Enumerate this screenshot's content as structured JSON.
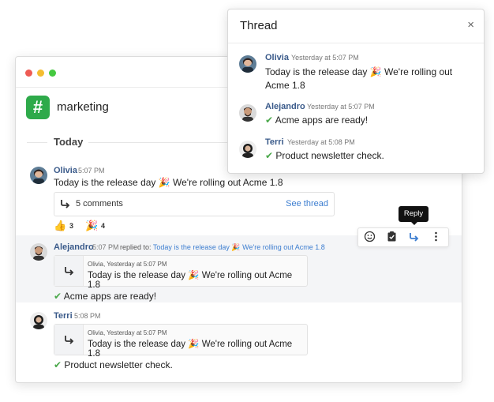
{
  "channel": {
    "name": "marketing",
    "hash_symbol": "#",
    "day_label": "Today"
  },
  "colors": {
    "accent": "#3d7ed0",
    "green": "#2eaa4a",
    "close": "#ee5b54",
    "minimize": "#f4bd30",
    "zoom": "#45c940"
  },
  "messages": [
    {
      "author": "Olivia",
      "time": "5:07 PM",
      "text": "Today is the release day 🎉 We're rolling out Acme 1.8"
    },
    {
      "author": "Alejandro",
      "time": "5:07 PM",
      "text": "Acme apps are ready!",
      "replied_prefix": "replied to:",
      "replied_text": "Today is the release day 🎉 We're rolling out Acme 1.8",
      "quote_meta": "Olivia, Yesterday at 5:07 PM",
      "quote_text": "Today is the release day 🎉 We're rolling out Acme 1.8"
    },
    {
      "author": "Terri",
      "time": "5:08 PM",
      "text": "Product newsletter check.",
      "quote_meta": "Olivia, Yesterday at 5:07 PM",
      "quote_text": "Today is the release day 🎉 We're rolling out Acme 1.8"
    }
  ],
  "comments": {
    "count_label": "5 comments",
    "see_thread": "See thread"
  },
  "reactions": [
    {
      "emoji": "👍",
      "count": "3"
    },
    {
      "emoji": "🎉",
      "count": "4"
    }
  ],
  "toolbar": {
    "tooltip": "Reply",
    "icons": [
      "smile-icon",
      "task-icon",
      "reply-icon",
      "more-icon"
    ]
  },
  "thread": {
    "title": "Thread",
    "close": "×",
    "items": [
      {
        "author": "Olivia",
        "time": "Yesterday at 5:07 PM",
        "text": "Today is the release day 🎉 We're rolling out Acme 1.8"
      },
      {
        "author": "Alejandro",
        "time": "Yesterday at 5:07 PM",
        "text": "Acme apps are ready!"
      },
      {
        "author": "Terri",
        "time": "Yesterday at 5:08 PM",
        "text": "Product newsletter check."
      }
    ]
  },
  "check_mark": "✔"
}
